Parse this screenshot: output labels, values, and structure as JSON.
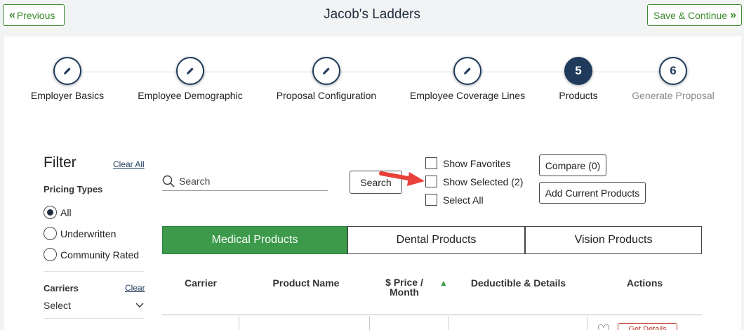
{
  "header": {
    "title": "Jacob's Ladders",
    "prev_label": "Previous",
    "next_label": "Save & Continue"
  },
  "steps": [
    {
      "label": "Employer Basics",
      "state": "done",
      "icon": "pencil-icon"
    },
    {
      "label": "Employee Demographic",
      "state": "done",
      "icon": "pencil-icon"
    },
    {
      "label": "Proposal Configuration",
      "state": "done",
      "icon": "pencil-icon"
    },
    {
      "label": "Employee Coverage Lines",
      "state": "done",
      "icon": "pencil-icon"
    },
    {
      "label": "Products",
      "state": "active",
      "number": "5"
    },
    {
      "label": "Generate Proposal",
      "state": "future",
      "number": "6"
    }
  ],
  "filter": {
    "title": "Filter",
    "clear_all": "Clear All",
    "pricing_title": "Pricing Types",
    "pricing_options": [
      "All",
      "Underwritten",
      "Community Rated"
    ],
    "pricing_selected": "All",
    "carriers_title": "Carriers",
    "carriers_clear": "Clear",
    "carriers_value": "Select"
  },
  "search": {
    "placeholder": "Search",
    "button_label": "Search"
  },
  "options": {
    "show_favorites": "Show Favorites",
    "show_selected": "Show Selected (2)",
    "select_all": "Select All"
  },
  "actions": {
    "compare": "Compare (0)",
    "add_current": "Add Current Products"
  },
  "tabs": [
    "Medical Products",
    "Dental Products",
    "Vision Products"
  ],
  "active_tab": "Medical Products",
  "table": {
    "headers": {
      "carrier": "Carrier",
      "product_name": "Product Name",
      "price_line1": "$ Price /",
      "price_line2": "Month",
      "deductible": "Deductible & Details",
      "actions": "Actions"
    },
    "row_button": "Get Details"
  },
  "colors": {
    "brand_green": "#3c9a4a",
    "navy": "#1f3a5a",
    "arrow_red": "#e8413a"
  }
}
